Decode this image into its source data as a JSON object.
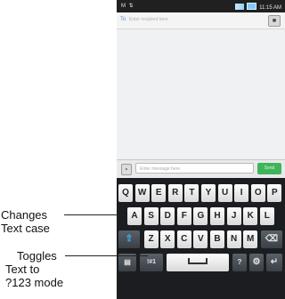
{
  "status_bar": {
    "left": "M ⇅",
    "time": "11:15 AM"
  },
  "recipient": {
    "to_label": "To",
    "placeholder": "Enter recipient here"
  },
  "composer": {
    "attach_icon": "paperclip-icon",
    "placeholder": "Enter message here",
    "send_label": "Send"
  },
  "keyboard": {
    "row1": [
      "Q",
      "W",
      "E",
      "R",
      "T",
      "Y",
      "U",
      "I",
      "O",
      "P"
    ],
    "row2": [
      "A",
      "S",
      "D",
      "F",
      "G",
      "H",
      "J",
      "K",
      "L"
    ],
    "row3": [
      "Z",
      "X",
      "C",
      "V",
      "B",
      "N",
      "M"
    ],
    "shift_icon": "shift-arrow-icon",
    "backspace_icon": "backspace-icon",
    "symbol_key": "!#1",
    "question_key": "?",
    "settings_icon": "gear-icon",
    "enter_icon": "enter-icon"
  },
  "callouts": {
    "case": {
      "line1": "Changes",
      "line2": "Text case"
    },
    "mode": {
      "line1": "Toggles",
      "line2": "Text to",
      "line3": "?123 mode"
    }
  }
}
